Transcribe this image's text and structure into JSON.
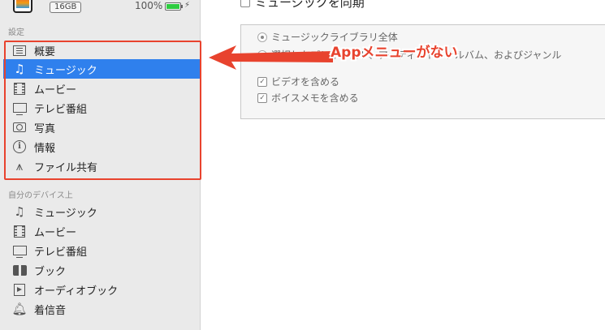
{
  "device": {
    "capacity": "16GB",
    "battery_percent": "100%",
    "battery_level": 1.0,
    "charge_glyph": "⚡"
  },
  "sidebar": {
    "settings_header": "設定",
    "settings_items": [
      {
        "label": "概要",
        "icon": "list-icon"
      },
      {
        "label": "ミュージック",
        "icon": "music-note-icon",
        "selected": true
      },
      {
        "label": "ムービー",
        "icon": "film-icon"
      },
      {
        "label": "テレビ番組",
        "icon": "tv-icon"
      },
      {
        "label": "写真",
        "icon": "camera-icon"
      },
      {
        "label": "情報",
        "icon": "info-icon"
      },
      {
        "label": "ファイル共有",
        "icon": "app-store-icon"
      }
    ],
    "my_device_header": "自分のデバイス上",
    "my_device_items": [
      {
        "label": "ミュージック",
        "icon": "music-note-icon"
      },
      {
        "label": "ムービー",
        "icon": "film-icon"
      },
      {
        "label": "テレビ番組",
        "icon": "tv-icon"
      },
      {
        "label": "ブック",
        "icon": "book-icon"
      },
      {
        "label": "オーディオブック",
        "icon": "audiobook-icon"
      },
      {
        "label": "着信音",
        "icon": "bell-icon"
      }
    ]
  },
  "main": {
    "sync_label": "ミュージックを同期",
    "options": {
      "entire_library": "ミュージックライブラリ全体",
      "selected": "選択したプレイリスト、アーティスト、アルバム、およびジャンル",
      "include_videos": "ビデオを含める",
      "include_voice_memos": "ボイスメモを含める"
    }
  },
  "annotation": {
    "callout_text": "Appメニューがない",
    "color": "#e8432e"
  },
  "colors": {
    "selection": "#2f80ed",
    "sidebar_bg": "#eaeaea"
  }
}
